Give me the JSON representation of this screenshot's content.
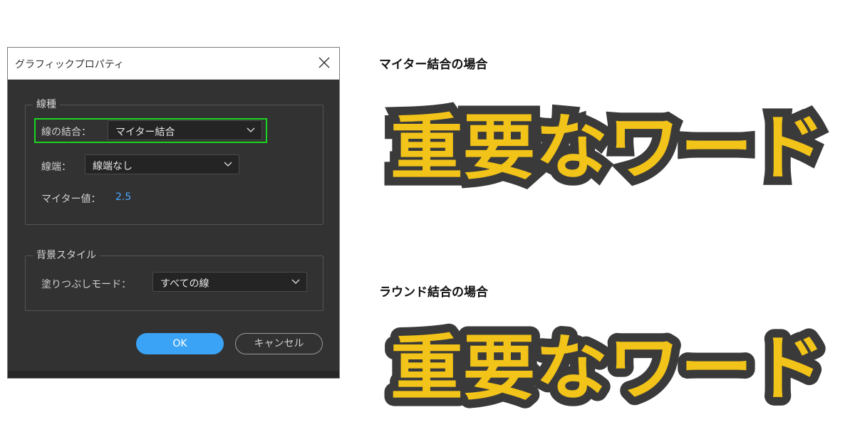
{
  "dialog": {
    "title": "グラフィックプロパティ",
    "stroke_group": {
      "legend": "線種",
      "join_label": "線の結合：",
      "join_value": "マイター結合",
      "cap_label": "線端：",
      "cap_value": "線端なし",
      "miter_label": "マイター値：",
      "miter_value": "2.5"
    },
    "bg_group": {
      "legend": "背景スタイル",
      "fill_label": "塗りつぶしモード：",
      "fill_value": "すべての線"
    },
    "ok_label": "OK",
    "cancel_label": "キャンセル"
  },
  "examples": {
    "miter_heading": "マイター結合の場合",
    "round_heading": "ラウンド結合の場合",
    "word": "重要なワード"
  },
  "colors": {
    "text_fill": "#f2c318",
    "text_stroke": "#3a3a3a",
    "highlight": "#19d51f",
    "ok_button": "#3aa3f5",
    "dialog_bg": "#323232"
  }
}
